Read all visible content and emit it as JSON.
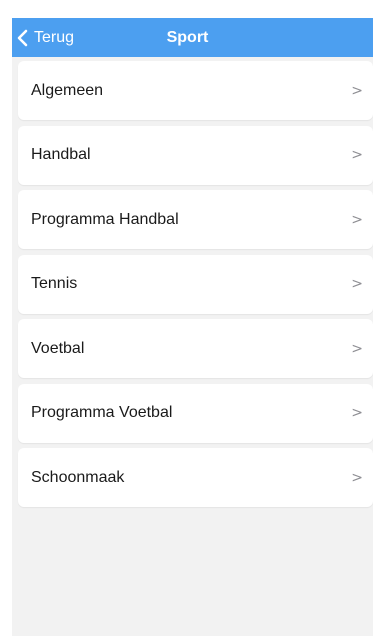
{
  "navbar": {
    "back_label": "Terug",
    "title": "Sport",
    "color": "#4c9ff0"
  },
  "list": {
    "chevron": ">",
    "items": [
      {
        "label": "Algemeen"
      },
      {
        "label": "Handbal"
      },
      {
        "label": "Programma Handbal"
      },
      {
        "label": "Tennis"
      },
      {
        "label": "Voetbal"
      },
      {
        "label": "Programma Voetbal"
      },
      {
        "label": "Schoonmaak"
      }
    ]
  }
}
